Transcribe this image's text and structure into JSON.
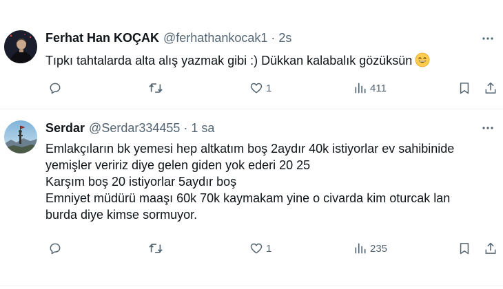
{
  "tweets": [
    {
      "name": "Ferhat Han KOÇAK",
      "handle": "@ferhathankocak1",
      "separator": "·",
      "time": "2s",
      "lines": [
        "Tıpkı tahtalarda alta alış yazmak gibi :) Dükkan kalabalık gözüksün"
      ],
      "emoji": "grinning-face-with-smiling-eyes",
      "likes": "1",
      "views": "411"
    },
    {
      "name": "Serdar",
      "handle": "@Serdar334455",
      "separator": "·",
      "time": "1 sa",
      "lines": [
        "Emlakçıların bk yemesi hep altkatım boş 2aydır 40k istiyorlar ev sahibinide",
        "yemişler veririz diye gelen giden yok ederi 20 25",
        "Karşım boş 20 istiyorlar 5aydır boş",
        "Emniyet müdürü maaşı 60k 70k kaymakam yine o civarda kim oturcak lan",
        "burda diye kimse sormuyor."
      ],
      "likes": "1",
      "views": "235"
    }
  ],
  "colors": {
    "text": "#0f1419",
    "secondary": "#536471",
    "divider": "#eff3f4"
  },
  "icons": [
    "reply-icon",
    "retweet-icon",
    "like-icon",
    "views-icon",
    "bookmark-icon",
    "share-icon",
    "more-icon"
  ]
}
